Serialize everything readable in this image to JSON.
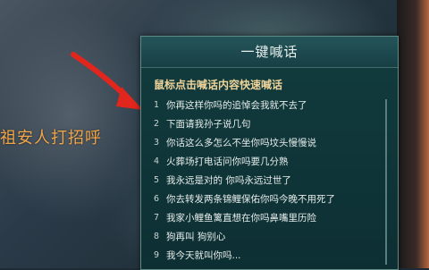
{
  "background": {
    "caption": "祖安人打招呼"
  },
  "panel": {
    "title": "一键喊话",
    "hint": "鼠标点击喊话内容快速喊话",
    "items": [
      {
        "num": "1",
        "text": "你再这样你吗的追悼会我就不去了"
      },
      {
        "num": "2",
        "text": "下面请我孙子说几句"
      },
      {
        "num": "3",
        "text": "你话这么多怎么不坐你吗坟头慢慢说"
      },
      {
        "num": "4",
        "text": "火葬场打电话问你吗要几分熟"
      },
      {
        "num": "5",
        "text": "我永远是对的  你吗永远过世了"
      },
      {
        "num": "6",
        "text": "你去转发两条锦鲤保佑你吗今晚不用死了"
      },
      {
        "num": "7",
        "text": "我家小鲤鱼篱直想在你吗鼻嘴里历险"
      },
      {
        "num": "8",
        "text": "狗再叫  狗别心"
      },
      {
        "num": "9",
        "text": "我今天就叫你吗..."
      }
    ]
  },
  "colors": {
    "caption": "#f2a64a",
    "hint": "#efd49a",
    "panel_bg": "#0d2f33"
  }
}
